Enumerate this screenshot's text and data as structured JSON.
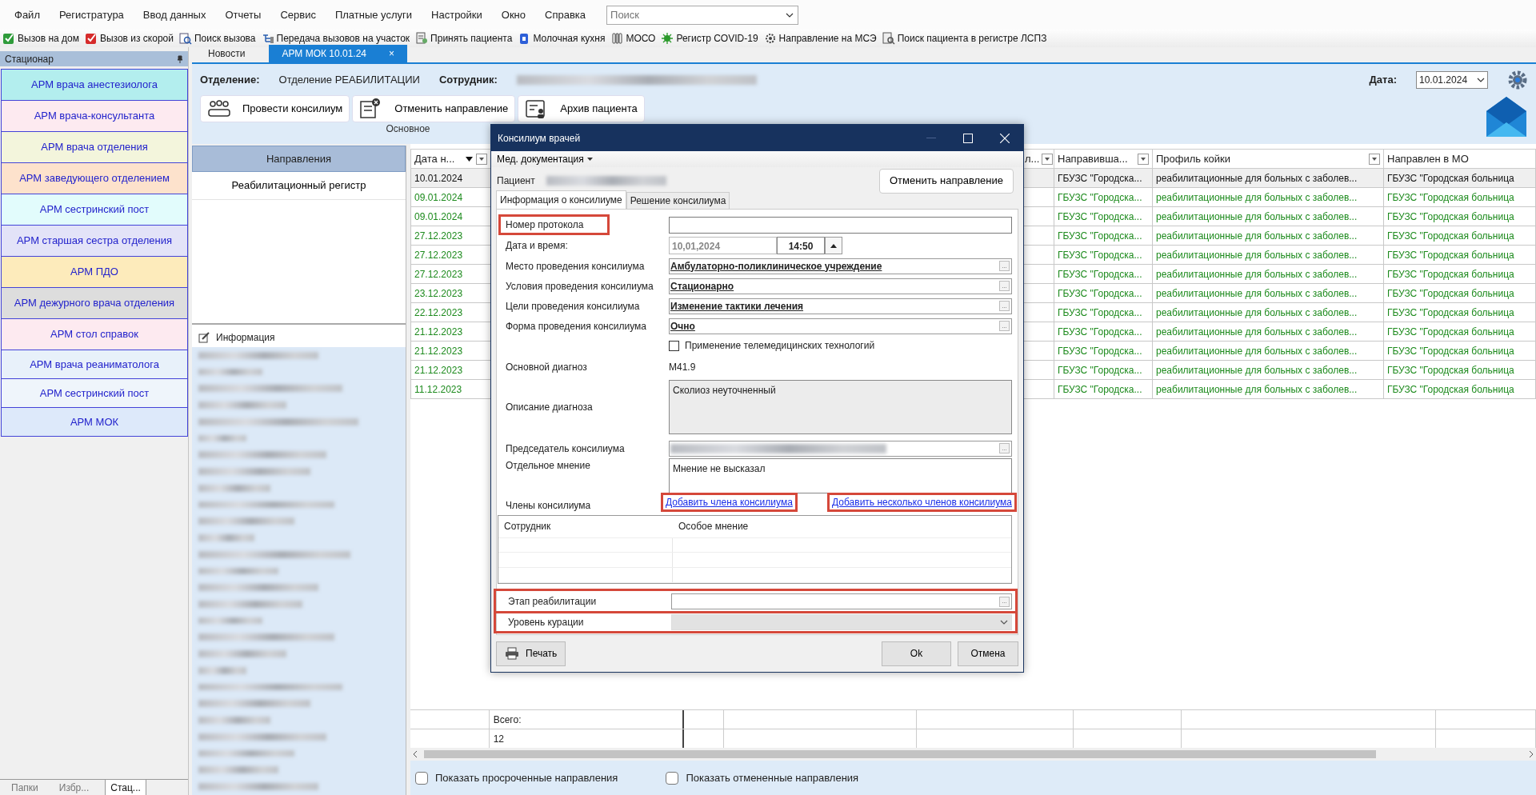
{
  "menu": [
    "Файл",
    "Регистратура",
    "Ввод данных",
    "Отчеты",
    "Сервис",
    "Платные услуги",
    "Настройки",
    "Окно",
    "Справка"
  ],
  "search": {
    "placeholder": "Поиск"
  },
  "toolbar": [
    "Вызов на дом",
    "Вызов из скорой",
    "Поиск вызова",
    "Передача вызовов на участок",
    "Принять пациента",
    "Молочная кухня",
    "МОСО",
    "Регистр COVID-19",
    "Направление на МСЭ",
    "Поиск пациента в регистре ЛСПЗ"
  ],
  "sidebar": {
    "title": "Стационар",
    "items": [
      {
        "label": "АРМ врача анестезиолога",
        "color": "#b3eeee"
      },
      {
        "label": "АРМ врача-консультанта",
        "color": "#fdeaf0"
      },
      {
        "label": "АРМ врача отделения",
        "color": "#f3f5dc"
      },
      {
        "label": "АРМ заведующего отделением",
        "color": "#fde2cc"
      },
      {
        "label": "АРМ сестринский пост",
        "color": "#e2fcfc"
      },
      {
        "label": "АРМ старшая сестра отделения",
        "color": "#e3e3f8"
      },
      {
        "label": "АРМ ПДО",
        "color": "#fdebbb"
      },
      {
        "label": "АРМ дежурного врача отделения",
        "color": "#dddddd"
      },
      {
        "label": "АРМ стол справок",
        "color": "#fdeaf0"
      },
      {
        "label": "АРМ врача реаниматолога",
        "color": "#e8f1fa"
      },
      {
        "label": "АРМ сестринский пост",
        "color": "#eff5fb"
      },
      {
        "label": "АРМ МОК",
        "color": "#dde9fa"
      }
    ],
    "bottom_tabs": [
      {
        "label": "Папки",
        "selected": false
      },
      {
        "label": "Избр...",
        "selected": false
      },
      {
        "label": "Стац...",
        "selected": true
      }
    ]
  },
  "doc_tabs": [
    {
      "label": "Новости",
      "selected": false
    },
    {
      "label": "АРМ МОК 10.01.24",
      "selected": true,
      "close": "×"
    }
  ],
  "header": {
    "department_label": "Отделение:",
    "department": "Отделение РЕАБИЛИТАЦИИ",
    "employee_label": "Сотрудник:",
    "date_label": "Дата:",
    "date": "10.01.2024",
    "ribbon": [
      "Провести консилиум",
      "Отменить направление",
      "Архив пациента"
    ],
    "ribbon_group": "Основное"
  },
  "nav": {
    "title": "Направления",
    "items": [
      "Реабилитационный регистр"
    ],
    "info_title": "Информация"
  },
  "grid": {
    "columns": [
      {
        "label": "Дата н...",
        "sorted": true,
        "filter": true
      },
      {
        "label": "л...",
        "sorted": false,
        "filter": true
      },
      {
        "label": "Направивша...",
        "sorted": false,
        "filter": true
      },
      {
        "label": "Профиль койки",
        "sorted": false,
        "filter": true
      },
      {
        "label": "Направлен в МО",
        "sorted": false,
        "filter": false
      }
    ],
    "rows": [
      {
        "date": "10.01.2024",
        "referrer": "ГБУЗС \"Городска...",
        "profile": "реабилитационные для больных с заболев...",
        "target": "ГБУЗС \"Городская больница",
        "selected": true
      },
      {
        "date": "09.01.2024",
        "referrer": "ГБУЗС \"Городска...",
        "profile": "реабилитационные для больных с заболев...",
        "target": "ГБУЗС \"Городская больница",
        "selected": false
      },
      {
        "date": "09.01.2024",
        "referrer": "ГБУЗС \"Городска...",
        "profile": "реабилитационные для больных с заболев...",
        "target": "ГБУЗС \"Городская больница",
        "selected": false
      },
      {
        "date": "27.12.2023",
        "referrer": "ГБУЗС \"Городска...",
        "profile": "реабилитационные для больных с заболев...",
        "target": "ГБУЗС \"Городская больница",
        "selected": false
      },
      {
        "date": "27.12.2023",
        "referrer": "ГБУЗС \"Городска...",
        "profile": "реабилитационные для больных с заболев...",
        "target": "ГБУЗС \"Городская больница",
        "selected": false
      },
      {
        "date": "27.12.2023",
        "referrer": "ГБУЗС \"Городска...",
        "profile": "реабилитационные для больных с заболев...",
        "target": "ГБУЗС \"Городская больница",
        "selected": false
      },
      {
        "date": "23.12.2023",
        "referrer": "ГБУЗС \"Городска...",
        "profile": "реабилитационные для больных с заболев...",
        "target": "ГБУЗС \"Городская больница",
        "selected": false
      },
      {
        "date": "22.12.2023",
        "referrer": "ГБУЗС \"Городска...",
        "profile": "реабилитационные для больных с заболев...",
        "target": "ГБУЗС \"Городская больница",
        "selected": false
      },
      {
        "date": "21.12.2023",
        "referrer": "ГБУЗС \"Городска...",
        "profile": "реабилитационные для больных с заболев...",
        "target": "ГБУЗС \"Городская больница",
        "selected": false
      },
      {
        "date": "21.12.2023",
        "referrer": "ГБУЗС \"Городска...",
        "profile": "реабилитационные для больных с заболев...",
        "target": "ГБУЗС \"Городская больница",
        "selected": false
      },
      {
        "date": "21.12.2023",
        "referrer": "ГБУЗС \"Городска...",
        "profile": "реабилитационные для больных с заболев...",
        "target": "ГБУЗС \"Городская больница",
        "selected": false
      },
      {
        "date": "11.12.2023",
        "referrer": "ГБУЗС \"Городска...",
        "profile": "реабилитационные для больных с заболев...",
        "target": "ГБУЗС \"Городская больница",
        "selected": false
      }
    ],
    "total_label": "Всего:",
    "total": "12"
  },
  "footer_checks": [
    {
      "label": "Показать просроченные направления",
      "checked": false
    },
    {
      "label": "Показать отмененные направления",
      "checked": false
    }
  ],
  "dialog": {
    "title": "Консилиум врачей",
    "menu": "Мед. документация",
    "patient_label": "Пациент",
    "cancel_button": "Отменить направление",
    "tabs": [
      {
        "label": "Информация о консилиуме",
        "selected": true
      },
      {
        "label": "Решение консилиума",
        "selected": false
      }
    ],
    "fields": [
      {
        "kind": "text",
        "label": "Номер протокола",
        "highlighted": true
      },
      {
        "kind": "datetime",
        "label": "Дата и время:",
        "date": "10,01,2024",
        "time": "14:50",
        "highlighted": false
      },
      {
        "kind": "lookup",
        "label": "Место проведения консилиума",
        "value": "Амбулаторно-поликлиническое учреждение",
        "button": "...",
        "highlighted": false
      },
      {
        "kind": "lookup",
        "label": "Условия проведения консилиума",
        "value": "Стационарно",
        "button": "...",
        "highlighted": false
      },
      {
        "kind": "lookup",
        "label": "Цели проведения консилиума",
        "value": "Изменение тактики лечения",
        "button": "...",
        "highlighted": false
      },
      {
        "kind": "lookup",
        "label": "Форма проведения консилиума",
        "value": "Очно",
        "button": "...",
        "highlighted": false
      },
      {
        "kind": "checkbox",
        "label": "Применение телемедицинских технологий",
        "checked": false
      },
      {
        "kind": "static",
        "label": "Основной диагноз",
        "value": "M41.9",
        "highlighted": false
      },
      {
        "kind": "memo",
        "label": "Описание диагноза",
        "value": "Сколиоз неуточненный",
        "disabled": true,
        "highlighted": false
      },
      {
        "kind": "lookup",
        "label": "Председатель консилиума",
        "blurred": true,
        "button": "...",
        "highlighted": false
      },
      {
        "kind": "memo",
        "label": "Отдельное мнение",
        "value": "Мнение не высказал",
        "disabled": false,
        "highlighted": false
      }
    ],
    "members": {
      "label": "Члены консилиума",
      "links": [
        {
          "label": "Добавить члена консилиума",
          "highlighted": true
        },
        {
          "label": "Добавить несколько членов консилиума",
          "highlighted": true
        }
      ],
      "columns": [
        "Сотрудник",
        "Особое мнение"
      ]
    },
    "stage_group": {
      "highlighted": true,
      "fields": [
        {
          "kind": "lookup",
          "label": "Этап реабилитации",
          "button": "..."
        },
        {
          "kind": "select",
          "label": "Уровень курации",
          "disabled": true
        }
      ]
    },
    "print_button": "Печать",
    "ok_button": "Ok",
    "cancel_dialog_button": "Отмена"
  }
}
